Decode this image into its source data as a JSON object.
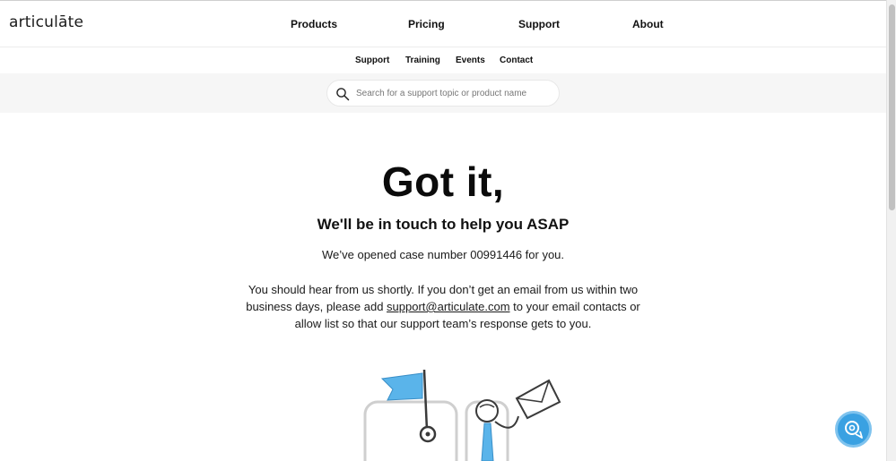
{
  "brand": {
    "logo_text": "articulāte"
  },
  "main_nav": {
    "products": "Products",
    "pricing": "Pricing",
    "support": "Support",
    "about": "About"
  },
  "sub_nav": {
    "support": "Support",
    "training": "Training",
    "events": "Events",
    "contact": "Contact"
  },
  "search": {
    "placeholder": "Search for a support topic or product name",
    "icon": "search-icon"
  },
  "confirmation": {
    "headline": "Got it,",
    "subheadline": "We'll be in touch to help you ASAP",
    "case_text": "We’ve opened case number 00991446 for you.",
    "message_before": "You should hear from us shortly. If you don’t get an email from us within two business days, please add ",
    "email_link": "support@articulate.com",
    "message_after": " to your email contacts or allow list so that our support team’s response gets to you."
  },
  "chat": {
    "icon": "chat-icon"
  },
  "colors": {
    "accent": "#3aa1e2",
    "search_band": "#f6f6f6",
    "text": "#111111",
    "flag_blue": "#5ab4ea"
  }
}
